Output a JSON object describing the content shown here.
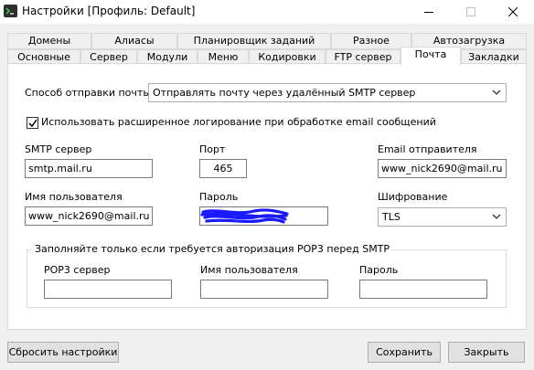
{
  "window": {
    "title": "Настройки [Профиль: Default]"
  },
  "tabs": {
    "row1": [
      "Домены",
      "Алиасы",
      "Планировщик заданий",
      "Разное",
      "Автозагрузка"
    ],
    "row2": [
      "Основные",
      "Сервер",
      "Модули",
      "Меню",
      "Кодировки",
      "FTP сервер",
      "Почта",
      "Закладки"
    ],
    "active": "Почта"
  },
  "mail": {
    "send_method_label": "Способ отправки почты:",
    "send_method_value": "Отправлять почту через удалённый SMTP сервер",
    "extended_logging_label": "Использовать расширенное логирование при обработке email сообщений",
    "extended_logging_checked": true,
    "smtp_server_label": "SMTP сервер",
    "smtp_server_value": "smtp.mail.ru",
    "port_label": "Порт",
    "port_value": "465",
    "sender_email_label": "Email отправителя",
    "sender_email_value": "www_nick2690@mail.ru",
    "username_label": "Имя пользователя",
    "username_value": "www_nick2690@mail.ru",
    "password_label": "Пароль",
    "encryption_label": "Шифрование",
    "encryption_value": "TLS"
  },
  "pop3": {
    "group_title": "Заполняйте только если требуется авторизация POP3 перед SMTP",
    "server_label": "POP3 сервер",
    "server_value": "",
    "username_label": "Имя пользователя",
    "username_value": "",
    "password_label": "Пароль",
    "password_value": ""
  },
  "buttons": {
    "reset": "Сбросить настройки",
    "save": "Сохранить",
    "close": "Закрыть"
  },
  "colors": {
    "password_redaction": "#1a1aff",
    "tab_border": "#d9d9d9",
    "button_bg": "#e1e1e1"
  }
}
